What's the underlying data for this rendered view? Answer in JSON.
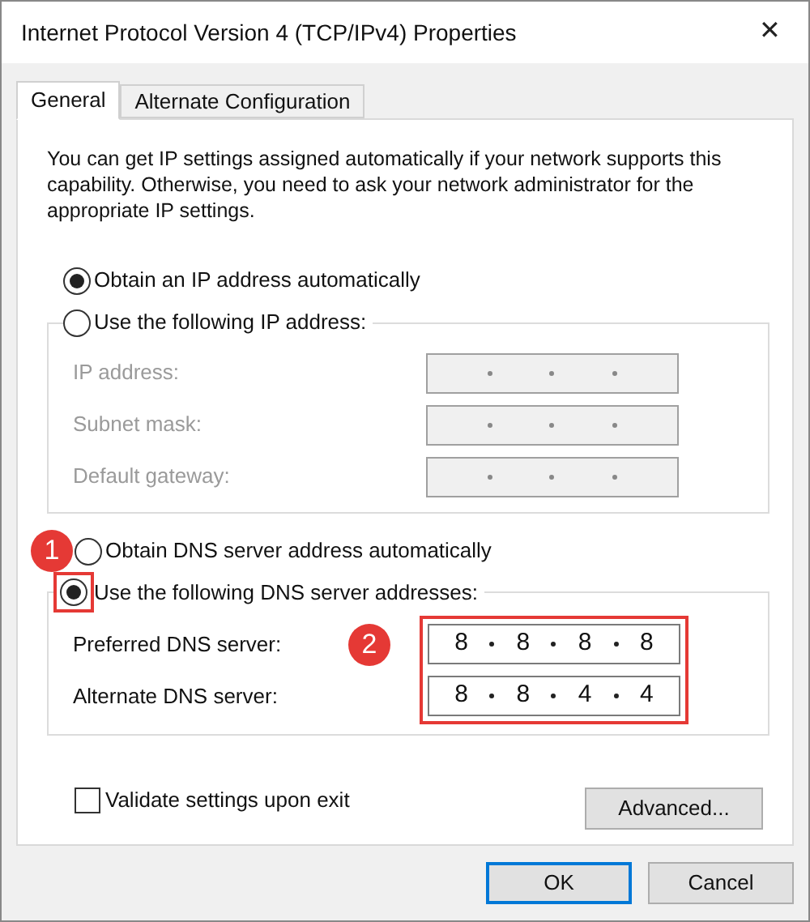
{
  "window": {
    "title": "Internet Protocol Version 4 (TCP/IPv4) Properties",
    "close": "✕"
  },
  "tabs": [
    {
      "label": "General",
      "selected": true
    },
    {
      "label": "Alternate Configuration",
      "selected": false
    }
  ],
  "description": "You can get IP settings assigned automatically if your network supports this capability. Otherwise, you need to ask your network administrator for the appropriate IP settings.",
  "ip_mode": [
    {
      "label": "Obtain an IP address automatically",
      "selected": true
    },
    {
      "label": "Use the following IP address:",
      "selected": false
    }
  ],
  "ip_fields": [
    {
      "label": "IP address:",
      "disabled": true
    },
    {
      "label": "Subnet mask:",
      "disabled": true
    },
    {
      "label": "Default gateway:",
      "disabled": true
    }
  ],
  "dns_mode": [
    {
      "label": "Obtain DNS server address automatically",
      "selected": false,
      "callout": "1"
    },
    {
      "label": "Use the following DNS server addresses:",
      "selected": true,
      "highlighted": true
    }
  ],
  "dns_fields": [
    {
      "label": "Preferred DNS server:",
      "disabled": false,
      "octets": [
        "8",
        "8",
        "8",
        "8"
      ]
    },
    {
      "label": "Alternate DNS server:",
      "disabled": false,
      "octets": [
        "8",
        "8",
        "4",
        "4"
      ]
    }
  ],
  "dns_callout": "2",
  "validate": {
    "label": "Validate settings upon exit",
    "checked": false
  },
  "advanced_button": "Advanced...",
  "buttons": [
    {
      "label": "OK",
      "default": true
    },
    {
      "label": "Cancel",
      "default": false
    }
  ]
}
